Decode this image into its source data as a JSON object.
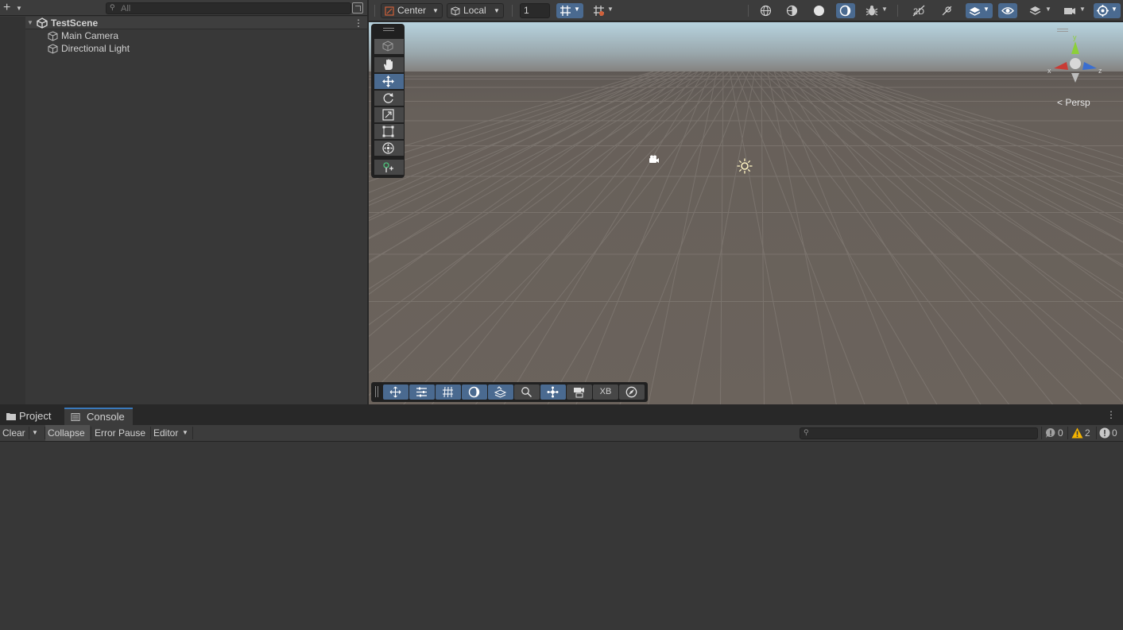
{
  "hierarchy": {
    "add_icon": "plus-icon",
    "search_placeholder": "All",
    "scene_name": "TestScene",
    "objects": [
      "Main Camera",
      "Directional Light"
    ]
  },
  "scene_toolbar": {
    "pivot_mode": "Center",
    "pivot_rotation": "Local",
    "snap_increment": "1"
  },
  "scene_view": {
    "projection_label": "Persp",
    "gizmo_axes": {
      "x": "x",
      "y": "y",
      "z": "z"
    },
    "overlay_xb_label": "XB",
    "colors": {
      "sky": "#a9c3cf",
      "ground": "#6a625c",
      "selection_blue": "#4a6a90",
      "x_axis": "#c83b35",
      "y_axis": "#8ccf3a",
      "z_axis": "#3a6ed0"
    }
  },
  "bottom_panel": {
    "tabs": [
      "Project",
      "Console"
    ],
    "active_tab": "Console"
  },
  "console_toolbar": {
    "clear_label": "Clear",
    "collapse_label": "Collapse",
    "error_pause_label": "Error Pause",
    "editor_label": "Editor",
    "search_value": "",
    "info_count": "0",
    "warning_count": "2",
    "error_count": "0"
  }
}
